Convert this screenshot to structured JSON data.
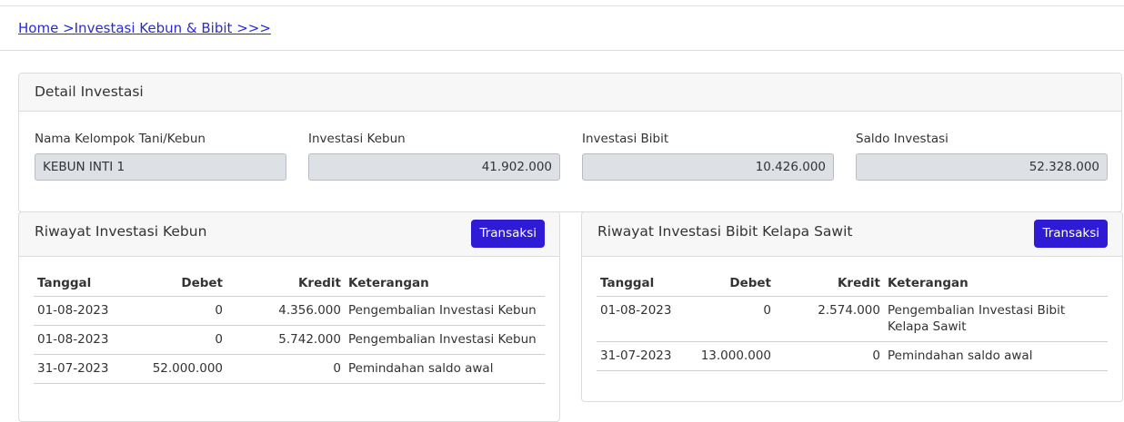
{
  "breadcrumb": {
    "text": "Home >Investasi Kebun & Bibit >>>"
  },
  "detail": {
    "title": "Detail Investasi",
    "fields": [
      {
        "label": "Nama Kelompok Tani/Kebun",
        "value": "KEBUN INTI 1"
      },
      {
        "label": "Investasi Kebun",
        "value": "41.902.000"
      },
      {
        "label": "Investasi Bibit",
        "value": "10.426.000"
      },
      {
        "label": "Saldo Investasi",
        "value": "52.328.000"
      }
    ]
  },
  "kebun": {
    "title": "Riwayat Investasi Kebun",
    "button": "Transaksi",
    "columns": {
      "tanggal": "Tanggal",
      "debet": "Debet",
      "kredit": "Kredit",
      "keterangan": "Keterangan"
    },
    "rows": [
      {
        "tanggal": "01-08-2023",
        "debet": "0",
        "kredit": "4.356.000",
        "keterangan": "Pengembalian Investasi Kebun"
      },
      {
        "tanggal": "01-08-2023",
        "debet": "0",
        "kredit": "5.742.000",
        "keterangan": "Pengembalian Investasi Kebun"
      },
      {
        "tanggal": "31-07-2023",
        "debet": "52.000.000",
        "kredit": "0",
        "keterangan": "Pemindahan saldo awal"
      }
    ]
  },
  "bibit": {
    "title": "Riwayat Investasi Bibit Kelapa Sawit",
    "button": "Transaksi",
    "columns": {
      "tanggal": "Tanggal",
      "debet": "Debet",
      "kredit": "Kredit",
      "keterangan": "Keterangan"
    },
    "rows": [
      {
        "tanggal": "01-08-2023",
        "debet": "0",
        "kredit": "2.574.000",
        "keterangan": "Pengembalian Investasi Bibit Kelapa Sawit"
      },
      {
        "tanggal": "31-07-2023",
        "debet": "13.000.000",
        "kredit": "0",
        "keterangan": "Pemindahan saldo awal"
      }
    ]
  },
  "colors": {
    "accent": "#2f1bd6",
    "link": "#2a2ad6",
    "input_bg": "#dde0e4"
  }
}
